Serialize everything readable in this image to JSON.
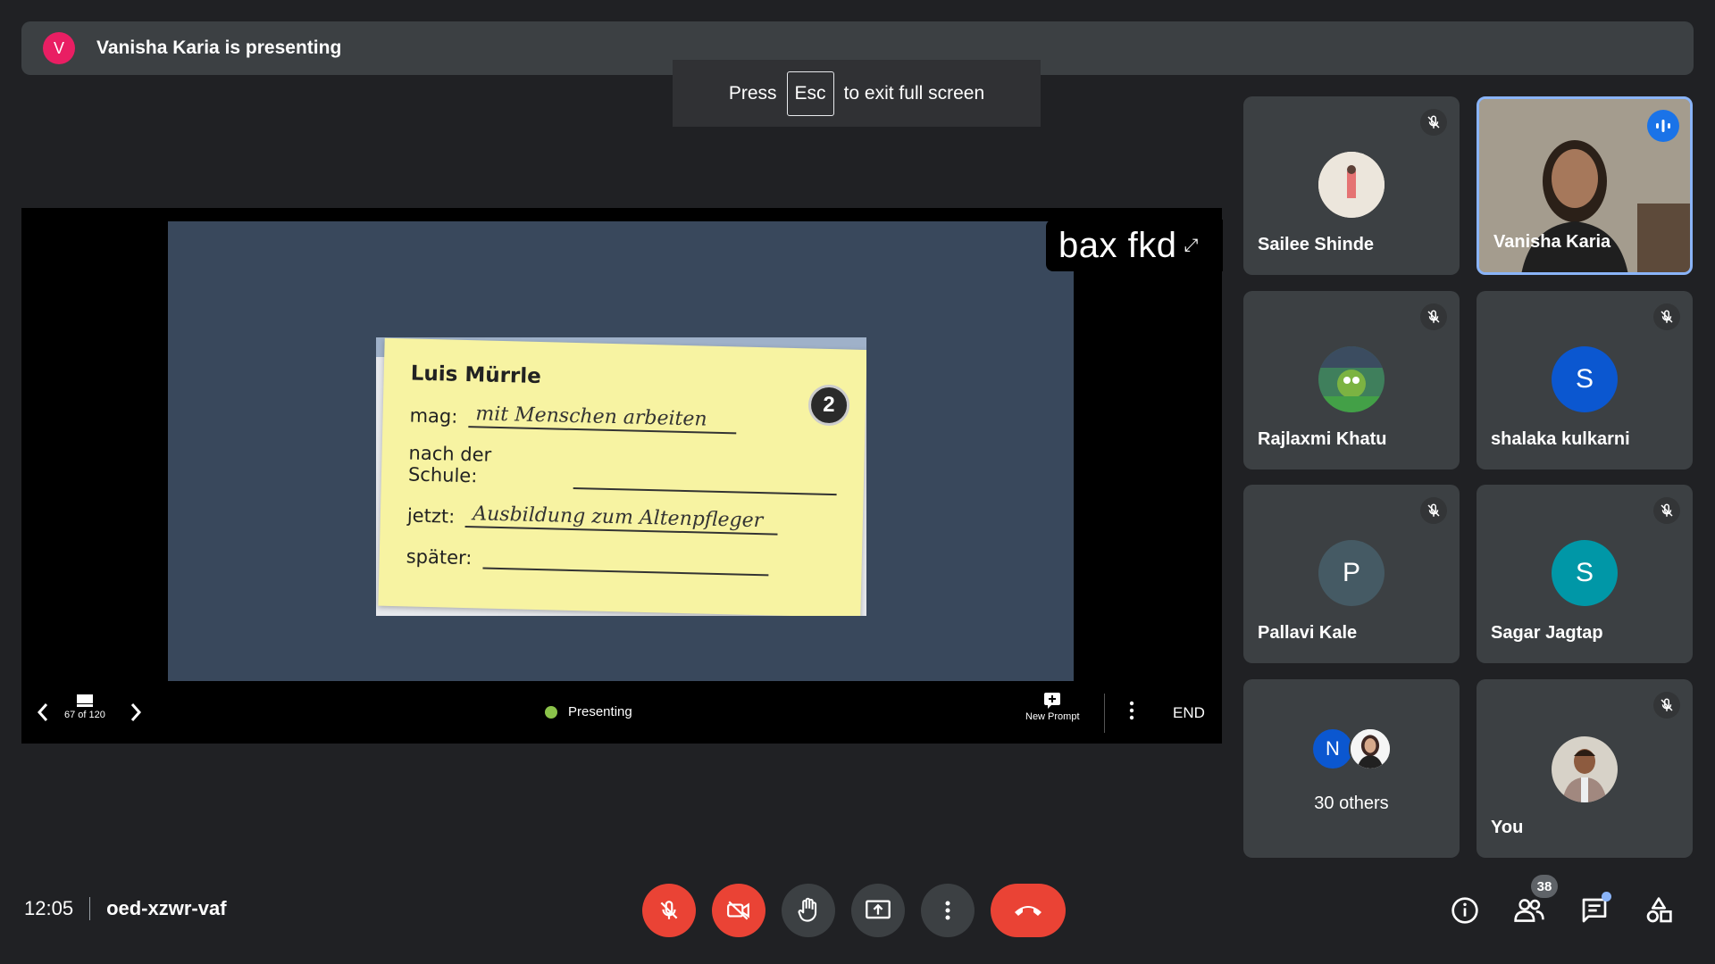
{
  "banner": {
    "avatar_letter": "V",
    "avatar_color": "#e91e63",
    "text": "Vanisha Karia is presenting"
  },
  "toast": {
    "before": "Press",
    "key": "Esc",
    "after": "to exit full screen"
  },
  "watermark": "bax fkd",
  "slide": {
    "name": "Luis Mürrle",
    "number": "2",
    "rows": [
      {
        "label": "mag:",
        "value": "mit Menschen arbeiten"
      },
      {
        "label": "nach der Schule:",
        "value": ""
      },
      {
        "label": "jetzt:",
        "value": "Ausbildung zum Altenpfleger"
      },
      {
        "label": "später:",
        "value": ""
      }
    ]
  },
  "controls": {
    "slide_count": "67 of 120",
    "status": "Presenting",
    "new_prompt": "New Prompt",
    "end": "END"
  },
  "participants": [
    {
      "name": "Sailee Shinde",
      "muted": true
    },
    {
      "name": "Vanisha Karia",
      "speaking": true
    },
    {
      "name": "Rajlaxmi Khatu",
      "muted": true
    },
    {
      "name": "shalaka kulkarni",
      "letter": "S",
      "color": "#0b57d0",
      "muted": true
    },
    {
      "name": "Pallavi Kale",
      "letter": "P",
      "color": "#455a64",
      "muted": true
    },
    {
      "name": "Sagar Jagtap",
      "letter": "S",
      "color": "#0097a7",
      "muted": true
    },
    {
      "name": "30 others",
      "letter": "N",
      "color": "#0b57d0"
    },
    {
      "name": "You",
      "muted": true
    }
  ],
  "bottom": {
    "time": "12:05",
    "meeting_code": "oed-xzwr-vaf",
    "participant_count": "38"
  },
  "colors": {
    "bg": "#202124",
    "tile": "#3c4043",
    "red": "#ea4335",
    "blue": "#8ab4f8"
  }
}
